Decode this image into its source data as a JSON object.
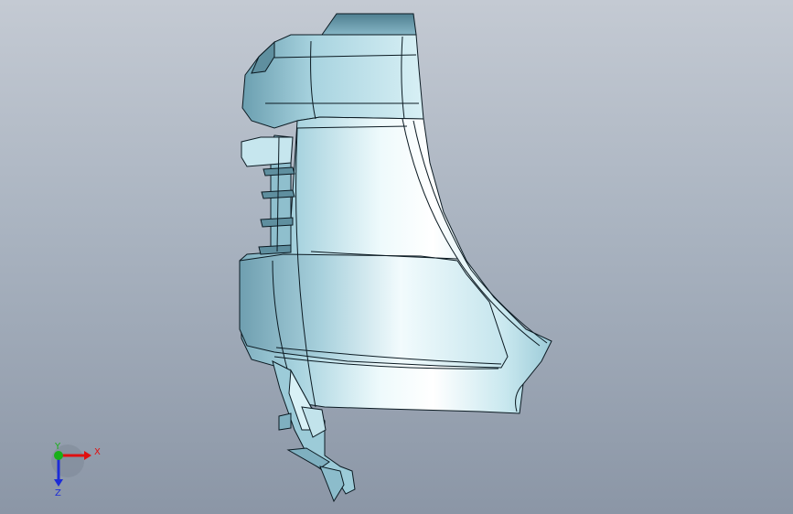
{
  "viewport": {
    "background_top": "#c4cad3",
    "background_bottom": "#8b96a6",
    "model_fill": "#b4dce6",
    "model_highlight": "#f2fbfd",
    "model_shadow": "#6fa2b3",
    "edge_color": "#0b1a22"
  },
  "triad": {
    "x_label": "X",
    "y_label": "Y",
    "z_label": "Z",
    "x_color": "#e01010",
    "y_color": "#18b018",
    "z_color": "#1c2cd8"
  }
}
